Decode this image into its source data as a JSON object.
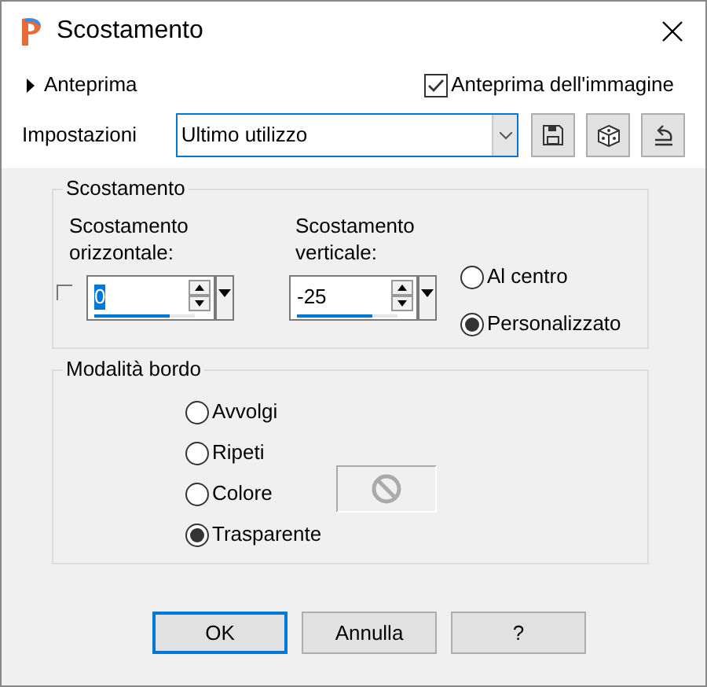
{
  "window": {
    "title": "Scostamento"
  },
  "preview": {
    "label": "Anteprima",
    "expanded": false
  },
  "image_preview": {
    "label": "Anteprima dell'immagine",
    "checked": true
  },
  "settings": {
    "label": "Impostazioni",
    "value": "Ultimo utilizzo"
  },
  "offset_group": {
    "title": "Scostamento",
    "link_checked": false,
    "fields": [
      {
        "label": "Scostamento orizzontale:",
        "value": "0",
        "level": 0.75,
        "selected": true
      },
      {
        "label": "Scostamento verticale:",
        "value": "-25",
        "level": 0.75,
        "selected": false
      }
    ],
    "options": [
      {
        "label": "Al centro",
        "selected": false
      },
      {
        "label": "Personalizzato",
        "selected": true
      }
    ]
  },
  "border_group": {
    "title": "Modalità bordo",
    "options": [
      {
        "label": "Avvolgi",
        "selected": false
      },
      {
        "label": "Ripeti",
        "selected": false
      },
      {
        "label": "Colore",
        "selected": false
      },
      {
        "label": "Trasparente",
        "selected": true
      }
    ]
  },
  "buttons": [
    {
      "label": "OK",
      "selected": true
    },
    {
      "label": "Annulla",
      "selected": false
    },
    {
      "label": "?",
      "selected": false
    }
  ]
}
